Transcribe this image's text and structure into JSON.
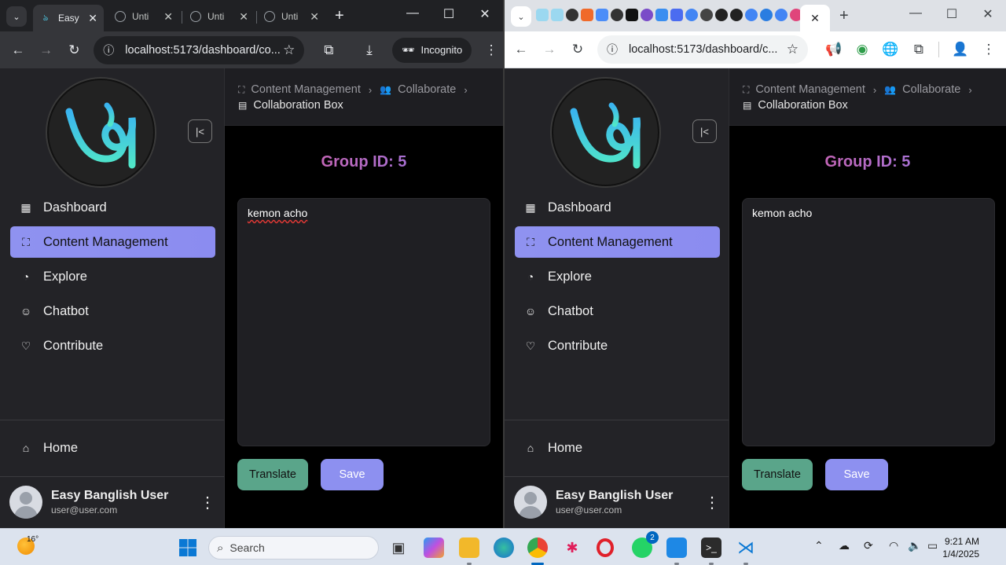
{
  "left_window": {
    "tabs": [
      {
        "label": "Easy",
        "active": true
      },
      {
        "label": "Unti"
      },
      {
        "label": "Unti"
      },
      {
        "label": "Unti"
      }
    ],
    "url": "localhost:5173/dashboard/co...",
    "profile_label": "Incognito"
  },
  "right_window": {
    "url": "localhost:5173/dashboard/c..."
  },
  "app": {
    "nav_items": [
      {
        "label": "Dashboard",
        "icon": "grid-icon"
      },
      {
        "label": "Content Management",
        "icon": "frame-icon",
        "active": true
      },
      {
        "label": "Explore",
        "icon": "compass-icon"
      },
      {
        "label": "Chatbot",
        "icon": "bot-icon"
      },
      {
        "label": "Contribute",
        "icon": "heart-hand-icon"
      }
    ],
    "home_label": "Home",
    "user": {
      "name": "Easy Banglish User",
      "email": "user@user.com"
    },
    "breadcrumb": {
      "item1": "Content Management",
      "item2": "Collaborate",
      "current": "Collaboration Box"
    },
    "group_title": "Group ID: 5",
    "editor_text": "kemon acho",
    "translate_label": "Translate",
    "save_label": "Save",
    "colors": {
      "accent": "#8d90f0",
      "translate": "#5aa58a",
      "title_gradient_start": "#e05a9a"
    }
  },
  "taskbar": {
    "temperature": "16°",
    "search_placeholder": "Search",
    "whatsapp_badge": "2",
    "time": "9:21 AM",
    "date": "1/4/2025"
  }
}
